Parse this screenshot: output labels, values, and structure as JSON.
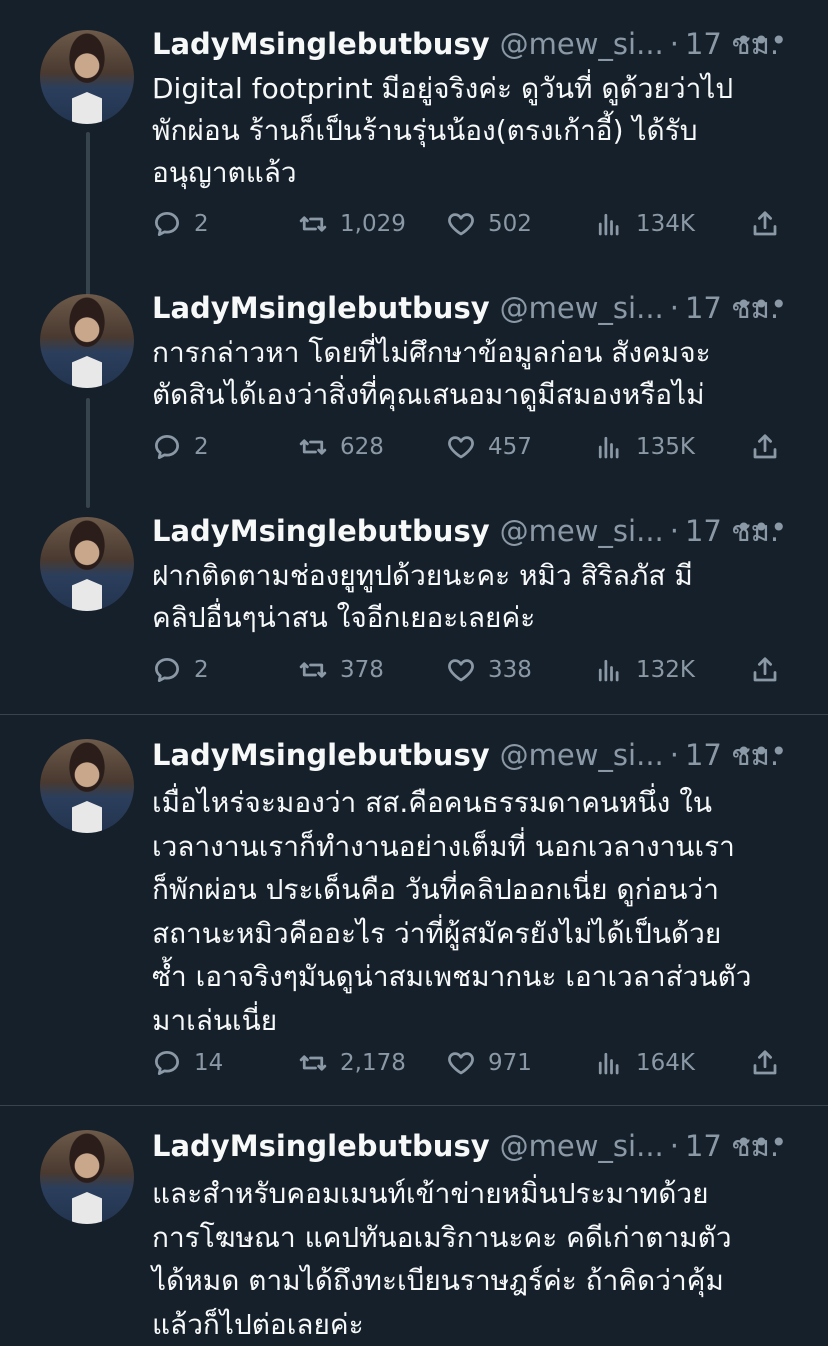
{
  "tweets": [
    {
      "name": "LadyMsinglebutbusy",
      "handle": "@mew_si...",
      "dot": "·",
      "time": "17 ชม.",
      "more": "•••",
      "lines": [
        "Digital footprint มีอยู่จริงค่ะ ดูวันที่ ดูด้วยว่าไป",
        "พักผ่อน ร้านก็เป็นร้านรุ่นน้อง(ตรงเก้าอี้) ได้รับ",
        "อนุญาตแล้ว"
      ],
      "replies": "2",
      "retweets": "1,029",
      "likes": "502",
      "views": "134K"
    },
    {
      "name": "LadyMsinglebutbusy",
      "handle": "@mew_si...",
      "dot": "·",
      "time": "17 ชม.",
      "more": "•••",
      "lines": [
        "การกล่าวหา โดยที่ไม่ศึกษาข้อมูลก่อน สังคมจะ",
        "ตัดสินได้เองว่าสิ่งที่คุณเสนอมาดูมีสมองหรือไม่"
      ],
      "replies": "2",
      "retweets": "628",
      "likes": "457",
      "views": "135K"
    },
    {
      "name": "LadyMsinglebutbusy",
      "handle": "@mew_si...",
      "dot": "·",
      "time": "17 ชม.",
      "more": "•••",
      "lines": [
        "ฝากติดตามช่องยูทูปด้วยนะคะ หมิว สิริลภัส มี",
        "คลิปอื่นๆน่าสน ใจอีกเยอะเลยค่ะ"
      ],
      "replies": "2",
      "retweets": "378",
      "likes": "338",
      "views": "132K"
    },
    {
      "name": "LadyMsinglebutbusy",
      "handle": "@mew_si...",
      "dot": "·",
      "time": "17 ชม.",
      "more": "•••",
      "lines": [
        "เมื่อไหร่จะมองว่า สส.คือคนธรรมดาคนหนึ่ง ใน",
        "เวลางานเราก็ทำงานอย่างเต็มที่ นอกเวลางานเรา",
        "ก็พักผ่อน ประเด็นคือ วันที่คลิปออกเนี่ย ดูก่อนว่า",
        "สถานะหมิวคืออะไร ว่าที่ผู้สมัครยังไม่ได้เป็นด้วย",
        "ซ้ำ เอาจริงๆมันดูน่าสมเพชมากนะ เอาเวลาส่วนตัว",
        "มาเล่นเนี่ย"
      ],
      "replies": "14",
      "retweets": "2,178",
      "likes": "971",
      "views": "164K"
    },
    {
      "name": "LadyMsinglebutbusy",
      "handle": "@mew_si...",
      "dot": "·",
      "time": "17 ชม.",
      "more": "•••",
      "lines": [
        "และสำหรับคอมเมนท์เข้าข่ายหมิ่นประมาทด้วย",
        "การโฆษณา แคปทันอเมริกานะคะ คดีเก่าตามตัว",
        "ได้หมด ตามได้ถึงทะเบียนราษฎร์ค่ะ ถ้าคิดว่าคุ้ม",
        "แล้วก็ไปต่อเลยค่ะ"
      ]
    }
  ]
}
